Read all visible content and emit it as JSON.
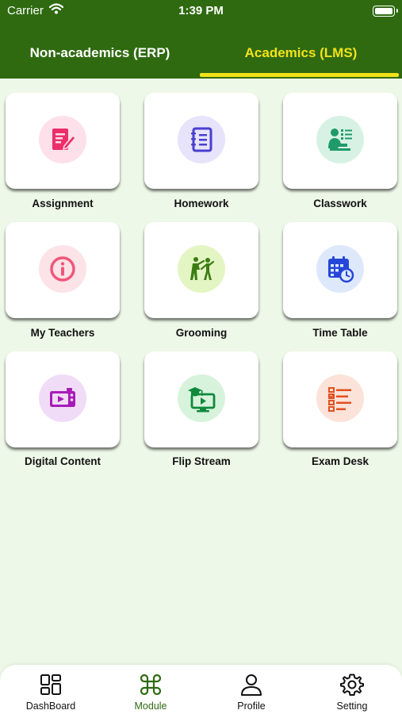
{
  "status_bar": {
    "carrier": "Carrier",
    "time": "1:39 PM"
  },
  "tabs": [
    {
      "label": "Non-academics (ERP)",
      "active": false
    },
    {
      "label": "Academics (LMS)",
      "active": true
    }
  ],
  "colors": {
    "header": "#2f6a10",
    "active_tab": "#f2e21a",
    "background": "#eef8e8"
  },
  "modules": [
    {
      "label": "Assignment",
      "icon": "assignment-icon"
    },
    {
      "label": "Homework",
      "icon": "homework-notebook-icon"
    },
    {
      "label": "Classwork",
      "icon": "classwork-icon"
    },
    {
      "label": "My Teachers",
      "icon": "info-icon"
    },
    {
      "label": "Grooming",
      "icon": "grooming-icon"
    },
    {
      "label": "Time Table",
      "icon": "calendar-clock-icon"
    },
    {
      "label": "Digital Content",
      "icon": "video-player-icon"
    },
    {
      "label": "Flip Stream",
      "icon": "flip-stream-icon"
    },
    {
      "label": "Exam Desk",
      "icon": "checklist-icon"
    }
  ],
  "bottom_nav": [
    {
      "label": "DashBoard",
      "icon": "grid-icon",
      "active": false
    },
    {
      "label": "Module",
      "icon": "command-icon",
      "active": true
    },
    {
      "label": "Profile",
      "icon": "user-icon",
      "active": false
    },
    {
      "label": "Setting",
      "icon": "gear-icon",
      "active": false
    }
  ]
}
